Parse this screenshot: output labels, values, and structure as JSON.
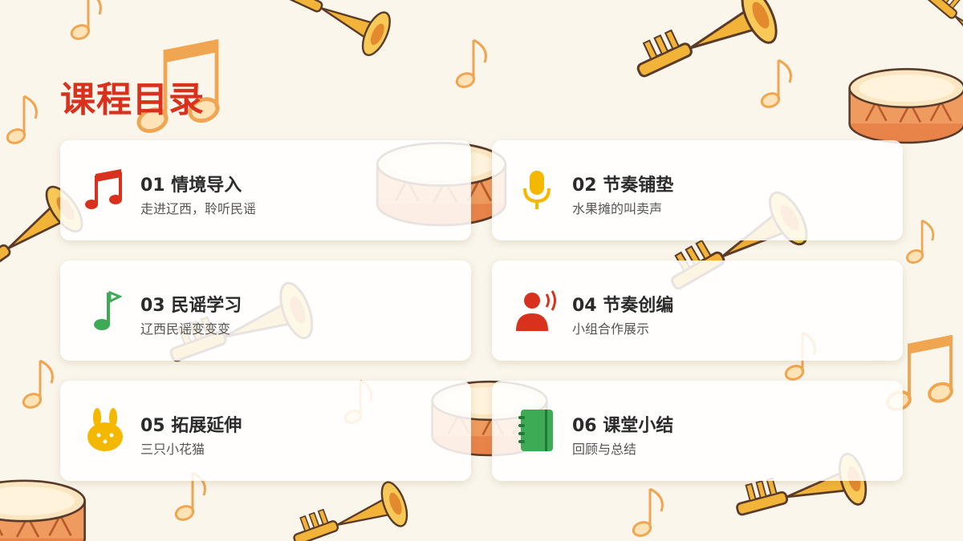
{
  "page": {
    "title": "课程目录"
  },
  "colors": {
    "title": "#d8321e",
    "note_red": "#d8321e",
    "mic_yellow": "#f5b800",
    "note_green": "#3daa55",
    "person_red": "#d8321e",
    "rabbit_yellow": "#f5b800",
    "notebook_green": "#3daa55"
  },
  "items": [
    {
      "title": "01 情境导入",
      "subtitle": "走进辽西，聆听民谣",
      "icon": "music-notes-icon"
    },
    {
      "title": "02 节奏铺垫",
      "subtitle": "水果摊的叫卖声",
      "icon": "microphone-icon"
    },
    {
      "title": "03 民谣学习",
      "subtitle": "辽西民谣变变变",
      "icon": "music-note-icon"
    },
    {
      "title": "04 节奏创编",
      "subtitle": "小组合作展示",
      "icon": "speaking-person-icon"
    },
    {
      "title": "05 拓展延伸",
      "subtitle": "三只小花猫",
      "icon": "bunny-icon"
    },
    {
      "title": "06 课堂小结",
      "subtitle": "回顾与总结",
      "icon": "notebook-icon"
    }
  ]
}
